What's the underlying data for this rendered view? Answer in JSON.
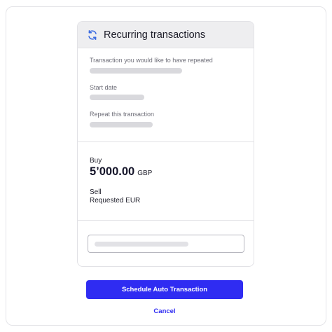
{
  "header": {
    "title": "Recurring transactions",
    "icon": "refresh-icon"
  },
  "fields": [
    {
      "label": "Transaction you would like to have repeated"
    },
    {
      "label": "Start date"
    },
    {
      "label": "Repeat this transaction"
    }
  ],
  "amount": {
    "buy_label": "Buy",
    "value": "5’000.00",
    "currency": "GBP",
    "sell_label": "Sell",
    "sell_value": "Requested EUR"
  },
  "actions": {
    "primary_label": "Schedule Auto Transaction",
    "cancel_label": "Cancel"
  },
  "colors": {
    "accent": "#2f2cf2",
    "header_bg": "#eeeef0",
    "placeholder": "#d9d9dd"
  }
}
